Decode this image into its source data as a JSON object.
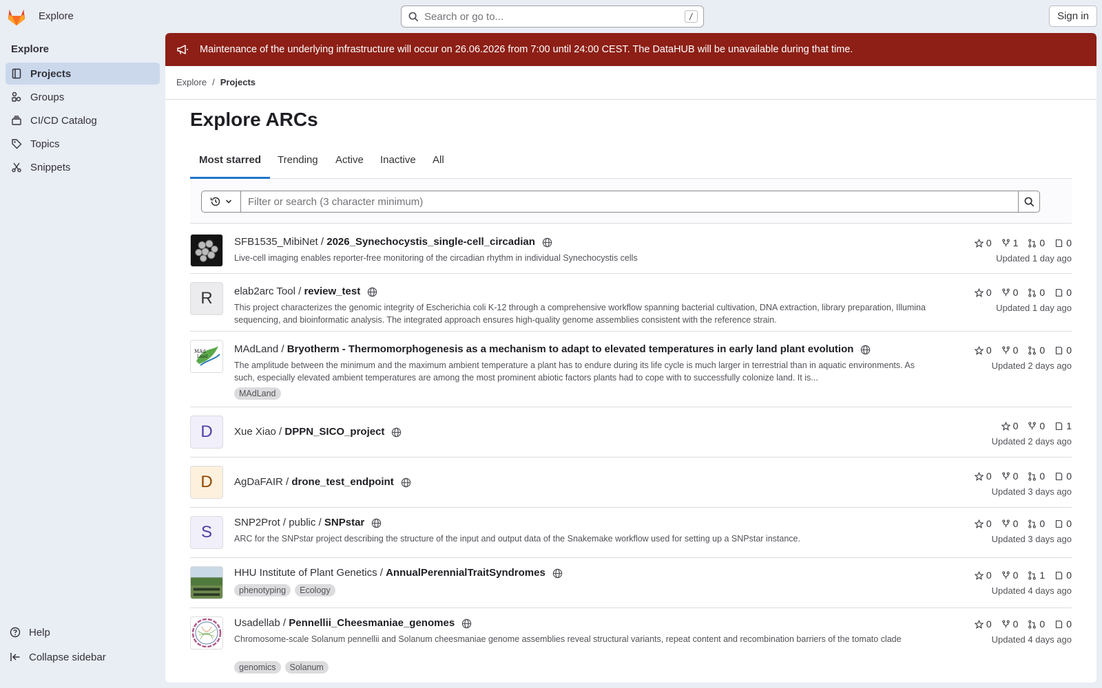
{
  "topbar": {
    "title": "Explore",
    "search_placeholder": "Search or go to...",
    "search_shortcut": "/",
    "signin_label": "Sign in"
  },
  "sidebar": {
    "heading": "Explore",
    "items": [
      {
        "label": "Projects",
        "icon": "project-icon",
        "active": true
      },
      {
        "label": "Groups",
        "icon": "group-icon"
      },
      {
        "label": "CI/CD Catalog",
        "icon": "catalog-icon"
      },
      {
        "label": "Topics",
        "icon": "tag-icon"
      },
      {
        "label": "Snippets",
        "icon": "snippet-icon"
      }
    ],
    "help_label": "Help",
    "collapse_label": "Collapse sidebar"
  },
  "banner": {
    "text": "Maintenance of the underlying infrastructure will occur on 26.06.2026 from 7:00 until 24:00 CEST. The DataHUB will be unavailable during that time.",
    "color": "#8d1f16"
  },
  "breadcrumb": {
    "root": "Explore",
    "separator": "/",
    "current": "Projects"
  },
  "page": {
    "title": "Explore ARCs"
  },
  "tabs": [
    "Most starred",
    "Trending",
    "Active",
    "Inactive",
    "All"
  ],
  "filter": {
    "placeholder": "Filter or search (3 character minimum)"
  },
  "projects": [
    {
      "namespace": "SFB1535_MibiNet / ",
      "name": "2026_Synechocystis_single-cell_circadian",
      "avatar": "image",
      "description": "Live-cell imaging enables reporter-free monitoring of the circadian rhythm in individual Synechocystis cells",
      "tags": [],
      "stars": "0",
      "forks": "1",
      "merge_requests": "0",
      "issues": "0",
      "updated": "Updated 1 day ago"
    },
    {
      "namespace": "elab2arc Tool / ",
      "name": "review_test",
      "avatar": "R",
      "description": "This project characterizes the genomic integrity of Escherichia coli K-12 through a comprehensive workflow spanning bacterial cultivation, DNA extraction, library preparation, Illumina sequencing, and bioinformatic analysis. The integrated approach ensures high-quality genome assemblies consistent with the reference strain.",
      "tags": [],
      "stars": "0",
      "forks": "0",
      "merge_requests": "0",
      "issues": "0",
      "updated": "Updated 1 day ago"
    },
    {
      "namespace": "MAdLand / ",
      "name": "Bryotherm - Thermomorphogenesis as a mechanism to adapt to elevated temperatures in early land plant evolution",
      "avatar": "image",
      "description": "The amplitude between the minimum and the maximum ambient temperature a plant has to endure during its life cycle is much larger in terrestrial than in aquatic environments. As such, especially elevated ambient temperatures are among the most prominent abiotic factors plants had to cope with to successfully colonize land. It is...",
      "tags": [
        "MAdLand"
      ],
      "stars": "0",
      "forks": "0",
      "merge_requests": "0",
      "issues": "0",
      "updated": "Updated 2 days ago"
    },
    {
      "namespace": "Xue Xiao / ",
      "name": "DPPN_SICO_project",
      "avatar": "D",
      "description": "",
      "tags": [],
      "stars": "0",
      "forks": "0",
      "merge_requests": "",
      "issues": "1",
      "updated": "Updated 2 days ago"
    },
    {
      "namespace": "AgDaFAIR / ",
      "name": "drone_test_endpoint",
      "avatar": "D",
      "description": "",
      "tags": [],
      "stars": "0",
      "forks": "0",
      "merge_requests": "0",
      "issues": "0",
      "updated": "Updated 3 days ago"
    },
    {
      "namespace": "SNP2Prot / public / ",
      "name": "SNPstar",
      "avatar": "S",
      "description": "ARC for the SNPstar project describing the structure of the input and output data of the Snakemake workflow used for setting up a SNPstar instance.",
      "tags": [],
      "stars": "0",
      "forks": "0",
      "merge_requests": "0",
      "issues": "0",
      "updated": "Updated 3 days ago"
    },
    {
      "namespace": "HHU Institute of Plant Genetics / ",
      "name": "AnnualPerennialTraitSyndromes",
      "avatar": "image",
      "description": "",
      "tags": [
        "phenotyping",
        "Ecology"
      ],
      "stars": "0",
      "forks": "0",
      "merge_requests": "1",
      "issues": "0",
      "updated": "Updated 4 days ago"
    },
    {
      "namespace": "Usadellab / ",
      "name": "Pennellii_Cheesmaniae_genomes",
      "avatar": "image",
      "description": "Chromosome-scale Solanum pennellii and Solanum cheesmaniae genome assemblies reveal structural variants, repeat content and recombination barriers of the tomato clade",
      "tags": [
        "genomics",
        "Solanum"
      ],
      "stars": "0",
      "forks": "0",
      "merge_requests": "0",
      "issues": "0",
      "updated": "Updated 4 days ago"
    }
  ]
}
